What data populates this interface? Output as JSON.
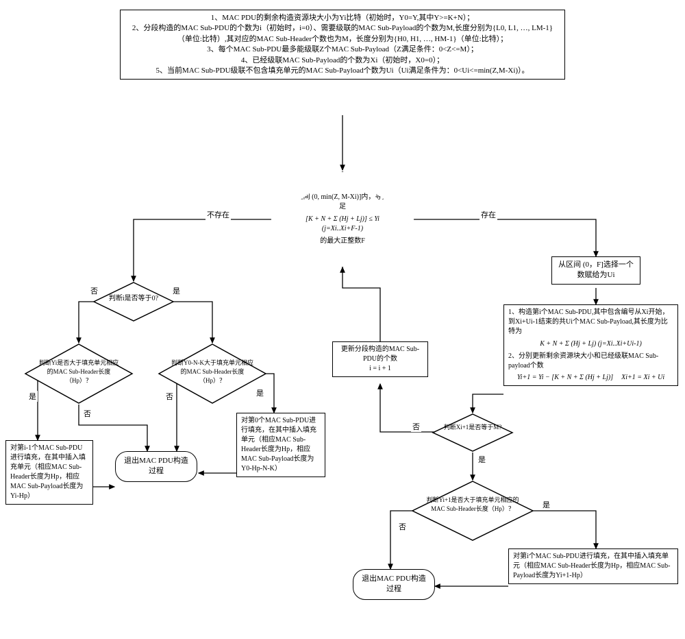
{
  "initBox": {
    "line1": "1、MAC PDU的剩余构造资源块大小为Yi比特（初始时，Y0=Y,其中Y>=K+N）；",
    "line2": "2、分段构造的MAC Sub-PDU的个数为i（初始时，i=0）、需要级联的MAC Sub-Payload的个数为M,长度分别为{L0, L1, …, LM-1}（单位:比特）,其对应的MAC Sub-Header个数也为M，长度分别为{H0, H1, …, HM-1}（单位:比特）；",
    "line3": "3、每个MAC Sub-PDU最多能级联Z个MAC Sub-Payload（Z满足条件：0<Z<=M）；",
    "line4": "4、已经级联MAC Sub-Payload的个数为Xi（初始时，X0=0）；",
    "line5": "5、当前MAC Sub-PDU级联不包含填充单元的MAC Sub-Payload个数为Ui（Ui满足条件为：0<Ui<=min(Z,M-Xi)）。"
  },
  "centerDecision": {
    "top": "在区间 (0, min(Z, M-Xi)]内，寻找满足",
    "formula": "[K + N + Σ (Hj + Lj)] ≤ Yi   (j=Xi..Xi+F-1)",
    "bottom": "的最大正整数F"
  },
  "labels": {
    "notExist": "不存在",
    "exist": "存在",
    "yes": "是",
    "no": "否"
  },
  "leftBranch": {
    "iZero": "判断i是否等于0?",
    "yiCheck": "判断Yi是否大于填充单元相应的MAC Sub-Header长度（Hp）？",
    "y0Check": "判断Y0-N-K大于填充单元相应的MAC Sub-Header长度（Hp）？",
    "fillPrev": "对第i-1个MAC Sub-PDU进行填充，在其中插入填充单元（相应MAC Sub-Header长度为Hp，相应MAC Sub-Payload长度为Yi-Hp）",
    "fill0": "对第0个MAC Sub-PDU进行填充，在其中插入填充单元（相应MAC Sub-Header长度为Hp，相应MAC Sub-Payload长度为Y0-Hp-N-K）",
    "exit": "退出MAC PDU构造过程"
  },
  "rightBranch": {
    "selectUi": "从区间 (0，F]选择一个数赋给为Ui",
    "construct": {
      "l1": "1、构造第i个MAC Sub-PDU,其中包含编号从Xi开始，到Xi+Ui-1结束的共Ui个MAC Sub-Payload,其长度为比特为",
      "f1": "K + N + Σ (Hj + Lj)   (j=Xi..Xi+Ui-1)",
      "l2": "2、分别更新剩余资源块大小和已经级联MAC Sub-payload个数",
      "f2a": "Yi+1 = Yi − [K + N + Σ (Hj + Lj)]",
      "f2b": "Xi+1 = Xi + Ui"
    },
    "xCheck": "判断Xi+1是否等于M?",
    "yCheck": "判断Yi+1是否大于填充单元相应的MAC Sub-Header长度（Hp）？",
    "updateI": "更新分段构造的MAC Sub-PDU的个数\ni = i + 1",
    "fillI": "对第i个MAC Sub-PDU进行填充，在其中插入填充单元（相应MAC Sub-Header长度为Hp，相应MAC Sub-Payload长度为Yi+1-Hp）",
    "exit": "退出MAC PDU构造过程"
  }
}
